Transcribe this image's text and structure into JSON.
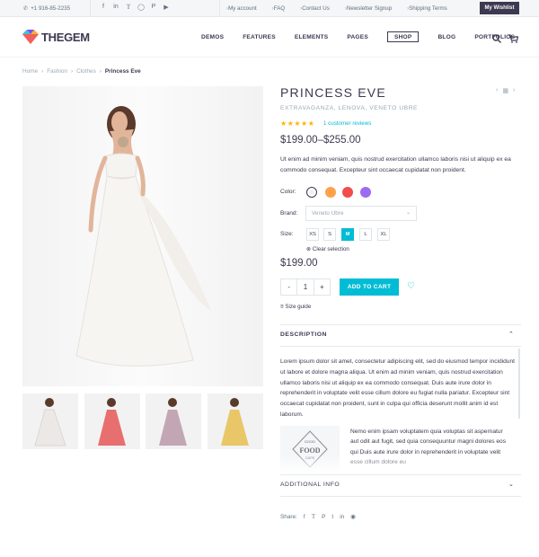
{
  "topbar": {
    "phone": "+1 916-85-2235",
    "socials": [
      "facebook-icon",
      "linkedin-icon",
      "twitter-icon",
      "instagram-icon",
      "pinterest-icon",
      "youtube-icon"
    ],
    "links": [
      "My account",
      "FAQ",
      "Contact Us",
      "Newsletter Signup",
      "Shipping Terms"
    ],
    "wishlist": "My Wishlist"
  },
  "header": {
    "logo_brand_a": "THE",
    "logo_brand_b": "GEM",
    "nav": [
      "DEMOS",
      "FEATURES",
      "ELEMENTS",
      "PAGES",
      "SHOP",
      "BLOG",
      "PORTFOLIOS"
    ],
    "active_nav": "SHOP"
  },
  "breadcrumb": {
    "items": [
      "Home",
      "Fashion",
      "Clothes"
    ],
    "current": "Princess Eve"
  },
  "product": {
    "title": "PRINCESS EVE",
    "categories": "EXTRAVAGANZA, LENOVA, VENETO UBRE",
    "rating": 5,
    "reviews": "1 customer reviews",
    "price_range": "$199.00–$255.00",
    "description": "Ut enim ad minim veniam, quis nostrud exercitation ullamco laboris nisi ut aliquip ex ea commodo consequat. Excepteur sint occaecat cupidatat non proident.",
    "color_label": "Color:",
    "colors": [
      "#f0f0ef",
      "#ffa14a",
      "#f24b4b",
      "#9b6cf0"
    ],
    "brand_label": "Brand:",
    "brand_value": "Veneto Ubre",
    "size_label": "Size:",
    "sizes": [
      "XS",
      "S",
      "M",
      "L",
      "XL"
    ],
    "selected_size": "M",
    "clear_selection": "Clear selection",
    "price": "$199.00",
    "quantity": "1",
    "qty_minus": "-",
    "qty_plus": "+",
    "add_to_cart": "ADD TO CART",
    "size_guide": "Size guide"
  },
  "description_section": {
    "title": "DESCRIPTION",
    "text": "Lorem ipsum dolor sit amet, consectetur adipiscing elit, sed do eiusmod tempor incididunt ut labore et dolore magna aliqua. Ut enim ad minim veniam, quis nostrud exercitation ullamco laboris nisi ut aliquip ex ea commodo consequat. Duis aute irure dolor in reprehenderit in voluptate velit esse cillum dolore eu fugiat nulla pariatur. Excepteur sint occaecat cupidatat non proident, sunt in culpa qui officia deserunt mollit anim id est laborum.",
    "image_text_top": "GOOD",
    "image_text_main": "FOOD",
    "image_text_bottom": "CAFE",
    "nemo_text": "Nemo enim ipsam voluptatem quia voluptas sit aspernatur aut odit aut fugit, sed quia consequuntur magni dolores eos qui Duis aute irure dolor in reprehenderit in voluptate velit esse cillum dolore eu"
  },
  "additional_info": {
    "title": "ADDITIONAL INFO"
  },
  "share": {
    "label": "Share:",
    "icons": [
      "facebook-icon",
      "twitter-icon",
      "pinterest-icon",
      "tumblr-icon",
      "linkedin-icon",
      "reddit-icon"
    ]
  },
  "thumb_colors": [
    "#ece8e6",
    "#e86f6f",
    "#c3a6b4",
    "#e9c668"
  ]
}
